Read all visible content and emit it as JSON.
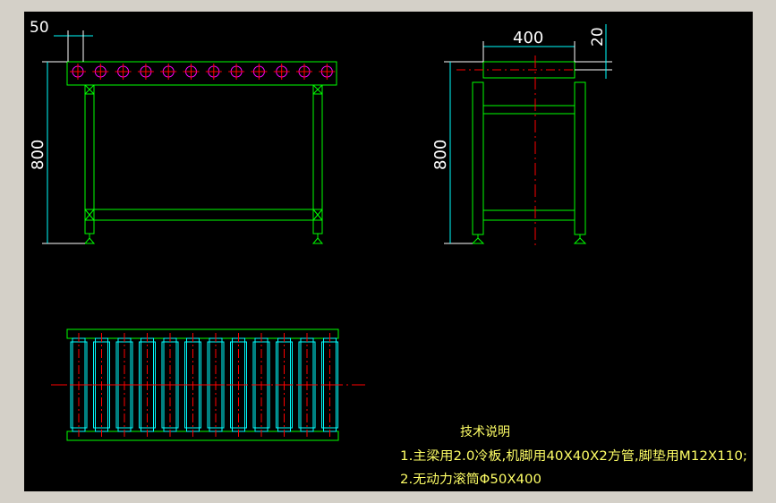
{
  "dimensions": {
    "front_pitch": "50",
    "front_height": "800",
    "side_width": "400",
    "side_top": "20",
    "side_height": "800"
  },
  "notes": {
    "title": "技术说明",
    "line1": "1.主梁用2.0冷板,机脚用40X40X2方管,脚垫用M12X110;",
    "line2": "2.无动力滚筒Φ50X400"
  },
  "front_view": {
    "roller_count": 12
  },
  "plan_view": {
    "roller_count": 12
  },
  "colors": {
    "frame": "#00ff00",
    "roller": "#ff00ff",
    "centerline": "#ff0000",
    "dimension": "#ffffff",
    "dimension_line": "#00ffff",
    "roller_plan": "#00ffff",
    "text": "#ffff66",
    "background": "#000000"
  }
}
